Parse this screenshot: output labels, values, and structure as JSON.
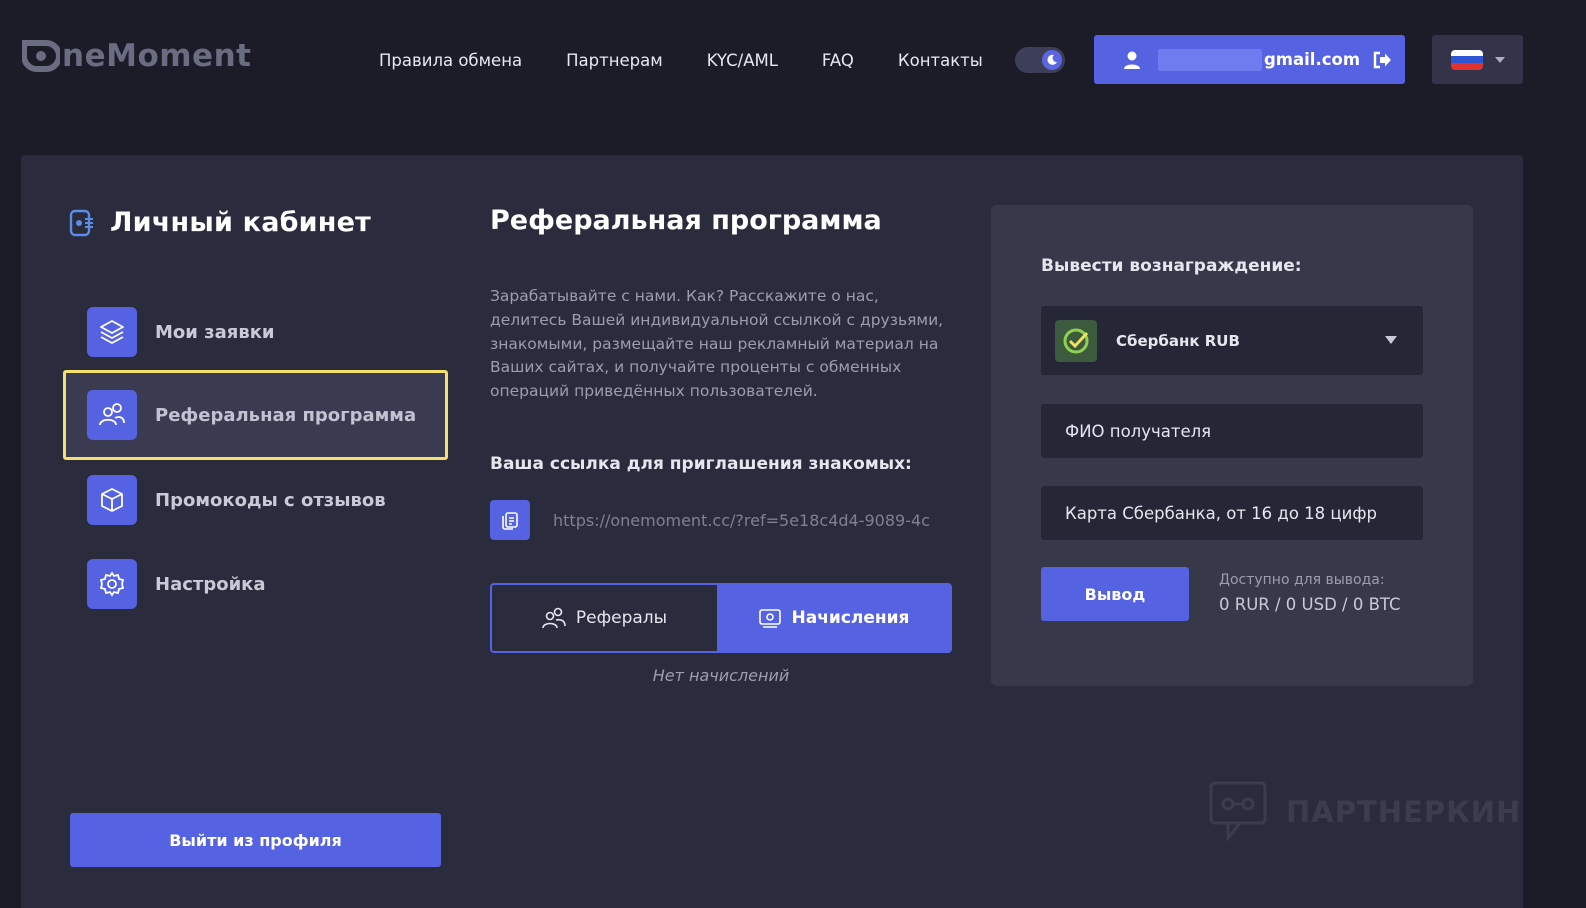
{
  "header": {
    "logo_text": "neMoment",
    "nav": [
      "Правила обмена",
      "Партнерам",
      "KYC/AML",
      "FAQ",
      "Контакты"
    ],
    "user_email": "gmail.com",
    "language": "ru"
  },
  "sidebar": {
    "title": "Личный кабинет",
    "items": [
      {
        "label": "Мои заявки",
        "icon": "layers-icon"
      },
      {
        "label": "Реферальная программа",
        "icon": "users-icon",
        "active": true
      },
      {
        "label": "Промокоды с отзывов",
        "icon": "box-icon"
      },
      {
        "label": "Настройка",
        "icon": "gear-icon"
      }
    ],
    "logout_label": "Выйти из профиля"
  },
  "referral": {
    "title": "Реферальная программа",
    "description": "Зарабатывайте с нами. Как? Расскажите о нас, делитесь Вашей индивидуальной ссылкой с друзьями, знакомыми, размещайте наш рекламный материал на Ваших сайтах, и получайте проценты с обменных операций приведённых пользователей.",
    "link_label": "Ваша ссылка для приглашения знакомых:",
    "link_value": "https://onemoment.cc/?ref=5e18c4d4-9089-4c",
    "tabs": [
      {
        "label": "Рефералы",
        "active": false
      },
      {
        "label": "Начисления",
        "active": true
      }
    ],
    "empty_note": "Нет начислений"
  },
  "withdraw": {
    "title": "Вывести вознаграждение:",
    "method": "Сбербанк RUB",
    "recipient_placeholder": "ФИО получателя",
    "card_placeholder": "Карта Сбербанка, от 16 до 18 цифр",
    "submit_label": "Вывод",
    "available_label": "Доступно для вывода:",
    "available_value": "0 RUR / 0 USD / 0 BTC"
  },
  "watermark": "ПАРТНЕРКИН",
  "colors": {
    "accent": "#5562e2",
    "background": "#1b1c27",
    "panel": "#2a2b3d",
    "highlight": "#f6df6b"
  }
}
